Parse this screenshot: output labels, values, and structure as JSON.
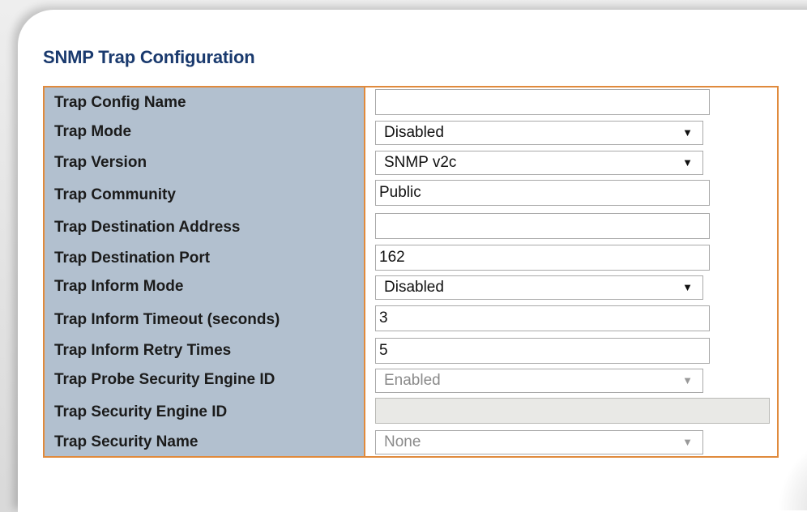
{
  "page": {
    "title": "SNMP Trap Configuration"
  },
  "colors": {
    "accent_border": "#e08a3c",
    "label_background": "#b2c0cf",
    "title_color": "#1a3a6e"
  },
  "rows": [
    {
      "label": "Trap Config Name",
      "type": "text",
      "value": "",
      "enabled": true
    },
    {
      "label": "Trap Mode",
      "type": "select",
      "value": "Disabled",
      "enabled": true
    },
    {
      "label": "Trap Version",
      "type": "select",
      "value": "SNMP v2c",
      "enabled": true
    },
    {
      "label": "Trap Community",
      "type": "text",
      "value": "Public",
      "enabled": true
    },
    {
      "label": "Trap Destination Address",
      "type": "text",
      "value": "",
      "enabled": true
    },
    {
      "label": "Trap Destination Port",
      "type": "text",
      "value": "162",
      "enabled": true
    },
    {
      "label": "Trap Inform Mode",
      "type": "select",
      "value": "Disabled",
      "enabled": true
    },
    {
      "label": "Trap Inform Timeout (seconds)",
      "type": "text",
      "value": "3",
      "enabled": true
    },
    {
      "label": "Trap Inform Retry Times",
      "type": "text",
      "value": "5",
      "enabled": true
    },
    {
      "label": "Trap Probe Security Engine ID",
      "type": "select",
      "value": "Enabled",
      "enabled": false
    },
    {
      "label": "Trap Security Engine ID",
      "type": "text",
      "value": "",
      "enabled": false
    },
    {
      "label": "Trap Security Name",
      "type": "select",
      "value": "None",
      "enabled": false
    }
  ],
  "icons": {
    "dropdown_arrow": "chevron-down-icon"
  }
}
